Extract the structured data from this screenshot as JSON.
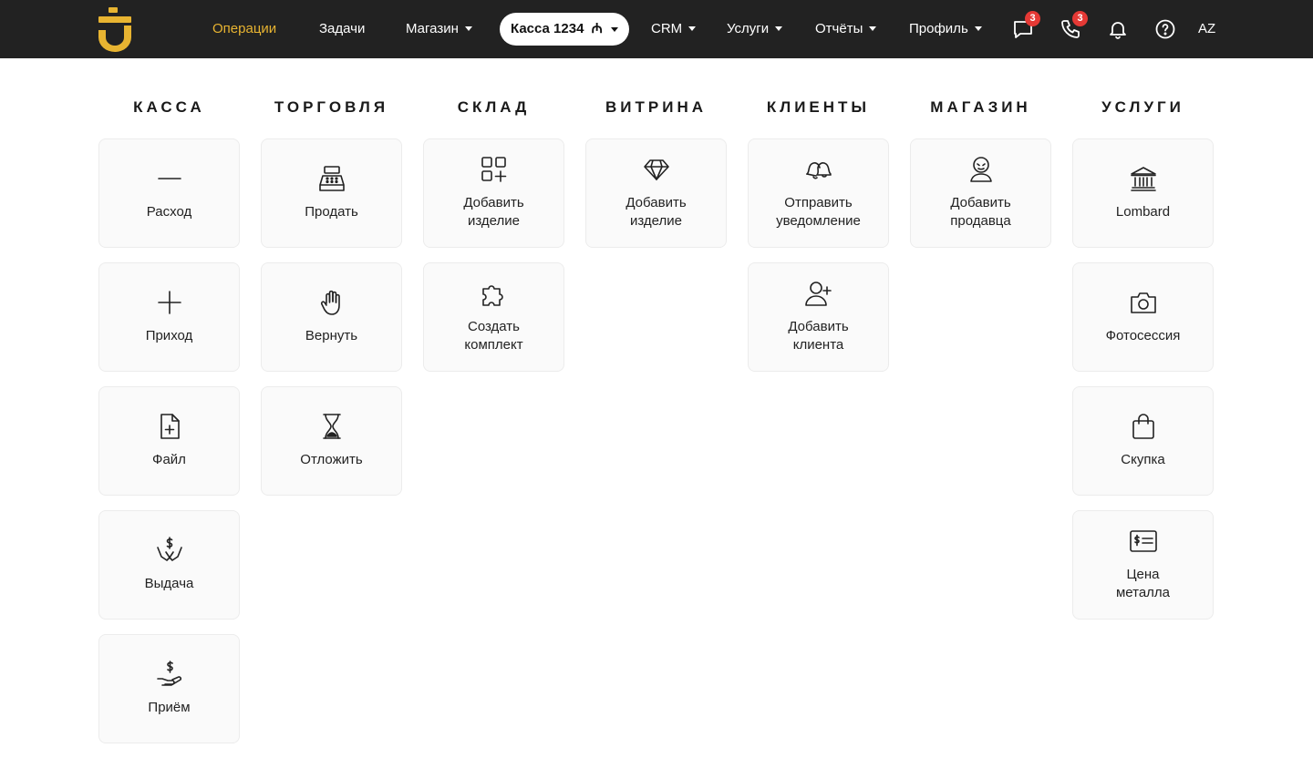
{
  "colors": {
    "accent": "#E8B431",
    "header_bg": "#222222",
    "badge": "#E53935",
    "card_bg": "#fafafa"
  },
  "header": {
    "logo_icon": "brand-logo",
    "nav": [
      {
        "label": "Операции",
        "active": true
      },
      {
        "label": "Задачи"
      },
      {
        "label": "Магазин",
        "dropdown": true
      },
      {
        "label": "CRM",
        "dropdown": true
      },
      {
        "label": "Услуги",
        "dropdown": true
      },
      {
        "label": "Отчёты",
        "dropdown": true
      },
      {
        "label": "Профиль",
        "dropdown": true
      }
    ],
    "kassa_selector": {
      "label": "Касса 1234",
      "currency": "₼"
    },
    "messages_badge": "3",
    "calls_badge": "3",
    "language": "AZ"
  },
  "columns": [
    {
      "title": "КАССА",
      "cards": [
        {
          "l1": "Расход",
          "icon": "minus-icon"
        },
        {
          "l1": "Приход",
          "icon": "plus-icon"
        },
        {
          "l1": "Файл",
          "icon": "file-add-icon"
        },
        {
          "l1": "Выдача",
          "icon": "hands-dollar-icon"
        },
        {
          "l1": "Приём",
          "icon": "hand-dollar-icon"
        }
      ]
    },
    {
      "title": "ТОРГОВЛЯ",
      "cards": [
        {
          "l1": "Продать",
          "icon": "cash-register-icon"
        },
        {
          "l1": "Вернуть",
          "icon": "hand-stop-icon"
        },
        {
          "l1": "Отложить",
          "icon": "hourglass-icon"
        }
      ]
    },
    {
      "title": "СКЛАД",
      "cards": [
        {
          "l1": "Добавить",
          "l2": "изделие",
          "icon": "grid-add-icon"
        },
        {
          "l1": "Создать",
          "l2": "комплект",
          "icon": "puzzle-icon"
        }
      ]
    },
    {
      "title": "ВИТРИНА",
      "cards": [
        {
          "l1": "Добавить",
          "l2": "изделие",
          "icon": "diamond-icon"
        }
      ]
    },
    {
      "title": "КЛИЕНТЫ",
      "cards": [
        {
          "l1": "Отправить",
          "l2": "уведомление",
          "icon": "bells-icon"
        },
        {
          "l1": "Добавить",
          "l2": "клиента",
          "icon": "user-add-icon"
        }
      ]
    },
    {
      "title": "МАГАЗИН",
      "cards": [
        {
          "l1": "Добавить",
          "l2": "продавца",
          "icon": "seller-icon"
        }
      ]
    },
    {
      "title": "УСЛУГИ",
      "cards": [
        {
          "l1": "Lombard",
          "icon": "bank-icon"
        },
        {
          "l1": "Фотосессия",
          "icon": "camera-icon"
        },
        {
          "l1": "Скупка",
          "icon": "shopping-bag-icon"
        },
        {
          "l1": "Цена",
          "l2": "металла",
          "icon": "price-tag-icon"
        }
      ]
    }
  ]
}
